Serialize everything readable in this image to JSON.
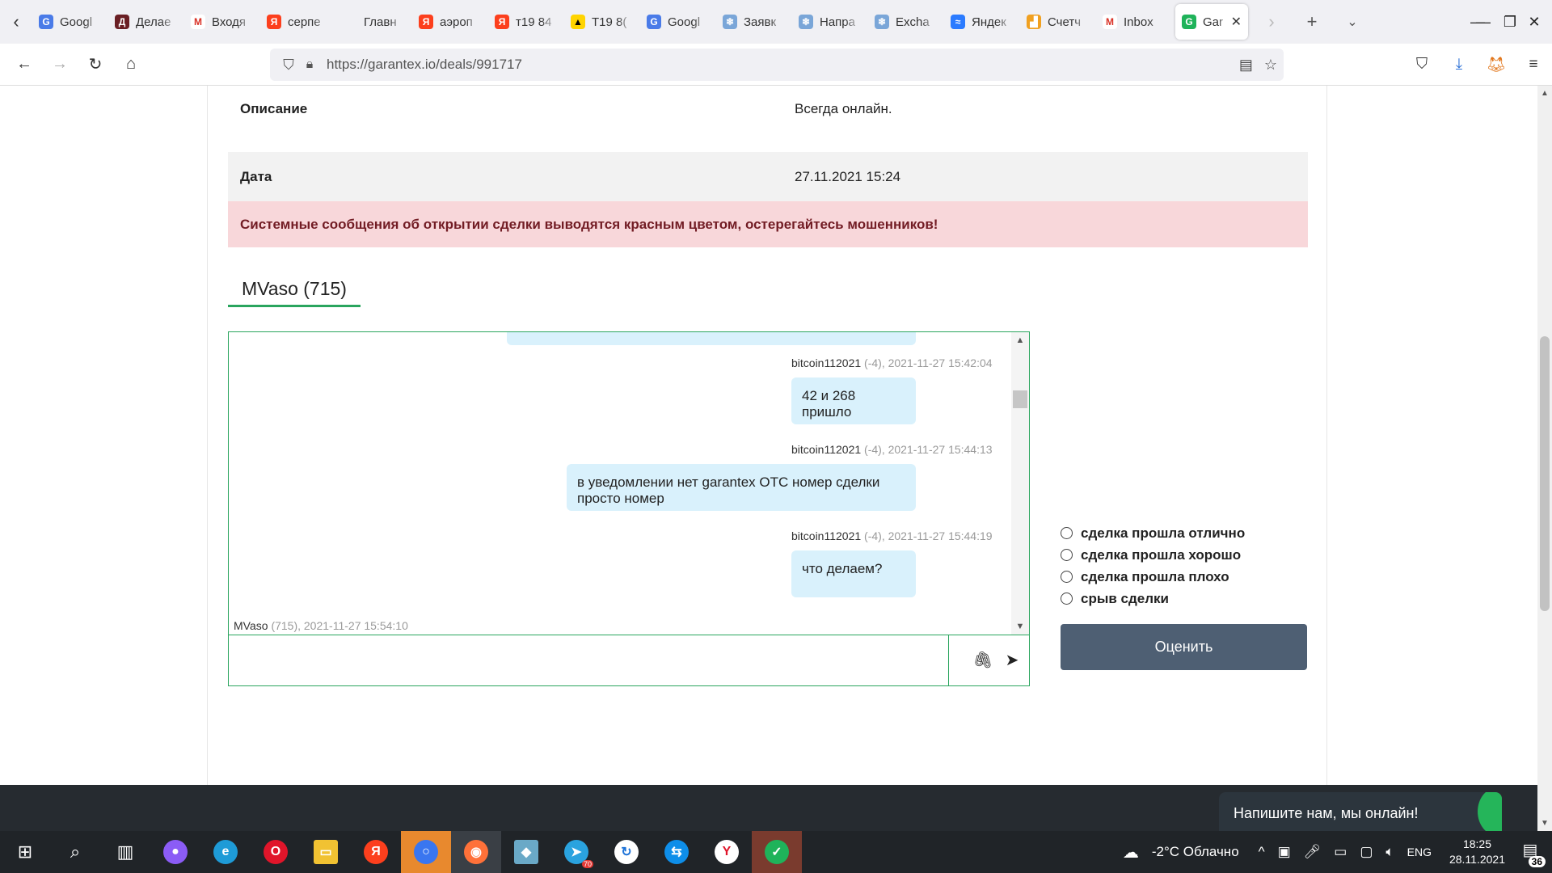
{
  "browser": {
    "tabs": [
      {
        "label": "Googl",
        "color": "#4a7be8",
        "glyph": "G"
      },
      {
        "label": "Делае",
        "color": "#6a1f24",
        "glyph": "Д"
      },
      {
        "label": "Входя",
        "color": "#ffffff",
        "glyph": "M"
      },
      {
        "label": "серпе",
        "color": "#fc3f1d",
        "glyph": "Я"
      },
      {
        "label": "Главн",
        "color": "#f0f0f4",
        "glyph": ""
      },
      {
        "label": "аэроп",
        "color": "#fc3f1d",
        "glyph": "Я"
      },
      {
        "label": "т19 84",
        "color": "#fc3f1d",
        "glyph": "Я"
      },
      {
        "label": "T19 8(",
        "color": "#ffd400",
        "glyph": "▲"
      },
      {
        "label": "Googl",
        "color": "#4a7be8",
        "glyph": "G"
      },
      {
        "label": "Заявк",
        "color": "#7aa6d8",
        "glyph": "❄"
      },
      {
        "label": "Напра",
        "color": "#7aa6d8",
        "glyph": "❄"
      },
      {
        "label": "Excha",
        "color": "#7aa6d8",
        "glyph": "❄"
      },
      {
        "label": "Яндек",
        "color": "#2b7bff",
        "glyph": "≈"
      },
      {
        "label": "Счетч",
        "color": "#f0a020",
        "glyph": "▟"
      },
      {
        "label": "Inbox",
        "color": "#ffffff",
        "glyph": "M"
      }
    ],
    "active_tab": {
      "label": "Gar",
      "color": "#1fb35a",
      "glyph": "G"
    },
    "url": "https://garantex.io/deals/991717"
  },
  "deal": {
    "description_label": "Описание",
    "description_value": "Всегда онлайн.",
    "date_label": "Дата",
    "date_value": "27.11.2021 15:24",
    "warning": "Системные сообщения об открытии сделки выводятся красным цветом, остерегайтесь мошенников!"
  },
  "chat": {
    "tab_label": "MVaso (715)",
    "messages": [
      {
        "user": "bitcoin112021",
        "meta": "(-4), 2021-11-27 15:42:04",
        "text": "42 и 268 пришло"
      },
      {
        "user": "bitcoin112021",
        "meta": "(-4), 2021-11-27 15:44:13",
        "text": "в уведомлении нет garantex OTC номер сделки просто номер"
      },
      {
        "user": "bitcoin112021",
        "meta": "(-4), 2021-11-27 15:44:19",
        "text": "что делаем?"
      }
    ],
    "last_partial": {
      "user": "MVaso",
      "meta": "(715), 2021-11-27 15:54:10"
    },
    "input_placeholder": ""
  },
  "rating": {
    "options": [
      "сделка прошла отлично",
      "сделка прошла хорошо",
      "сделка прошла плохо",
      "срыв сделки"
    ],
    "button_label": "Оценить"
  },
  "support_widget": {
    "text": "Напишите нам, мы онлайн!"
  },
  "taskbar": {
    "weather": "-2°C  Облачно",
    "lang": "ENG",
    "time": "18:25",
    "date": "28.11.2021",
    "notifications": "36",
    "telegram_badge": "70"
  }
}
